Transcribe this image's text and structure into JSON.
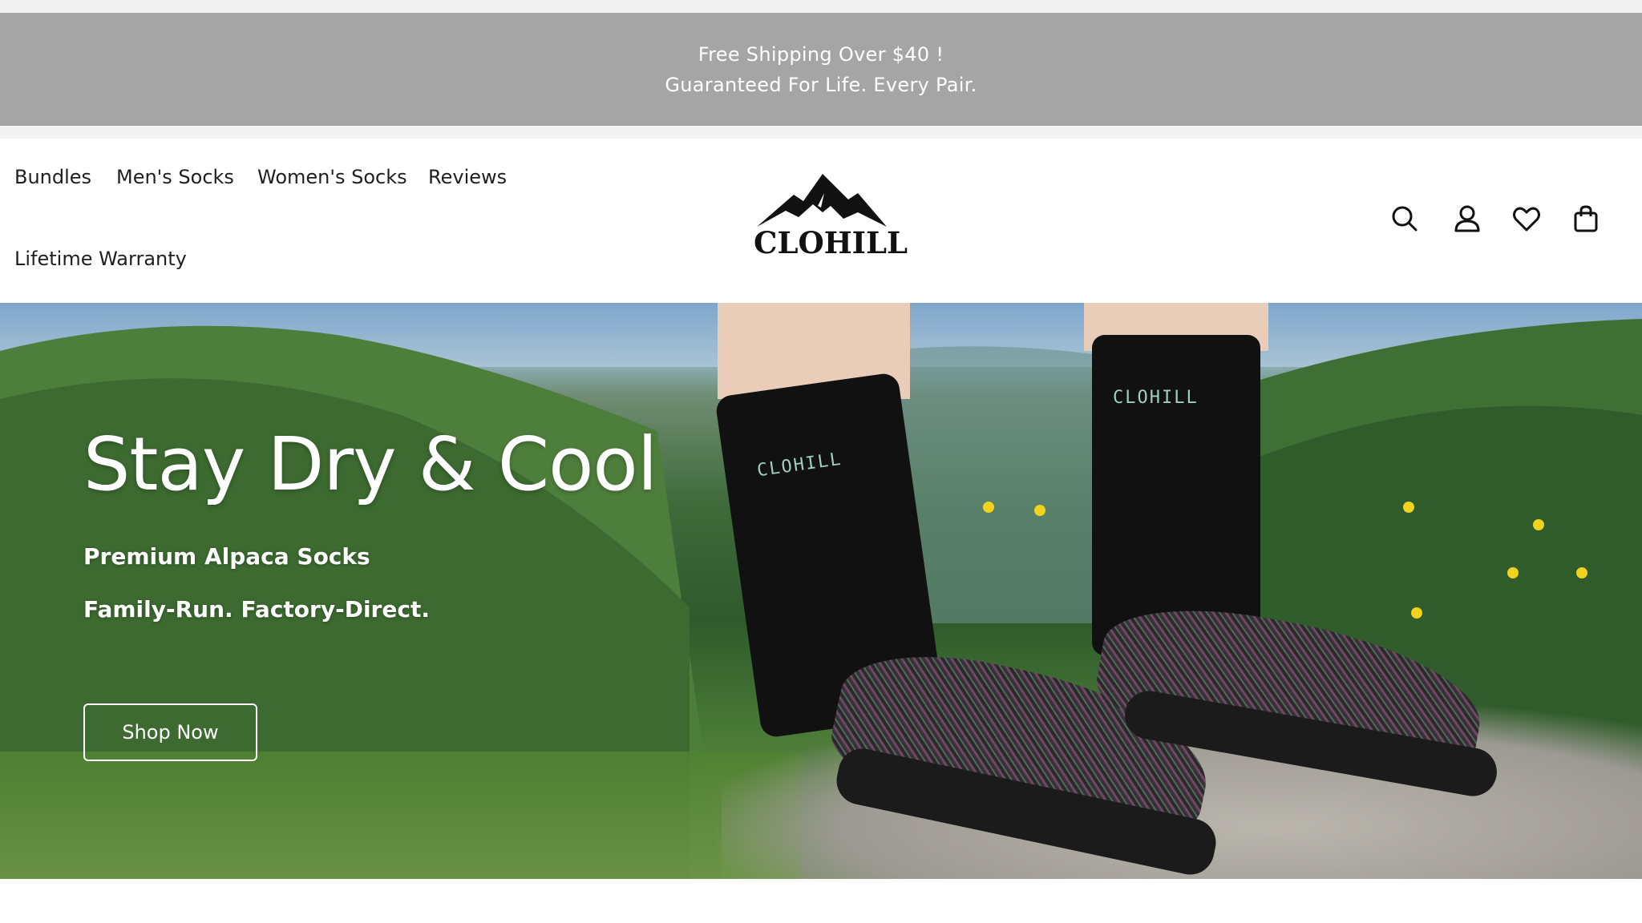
{
  "announcement": {
    "line1": "Free Shipping Over $40 !",
    "line2": "Guaranteed For Life. Every Pair."
  },
  "nav": {
    "items": [
      "Bundles",
      "Men's Socks",
      "Women's Socks",
      "Reviews",
      "Lifetime Warranty"
    ]
  },
  "logo": {
    "text": "CLOHILL"
  },
  "header_icons": [
    "search-icon",
    "account-icon",
    "wishlist-heart-icon",
    "cart-bag-icon"
  ],
  "hero": {
    "title": "Stay Dry & Cool",
    "subtitle1": "Premium Alpaca Socks",
    "subtitle2": "Family-Run. Factory-Direct.",
    "cta_label": "Shop Now",
    "sock_left_text": "CLOHILL",
    "sock_right_text": "CLOHILL"
  },
  "colors": {
    "announcement_bg": "#a5a5a5",
    "text_dark": "#1f1f1f",
    "white": "#ffffff"
  }
}
